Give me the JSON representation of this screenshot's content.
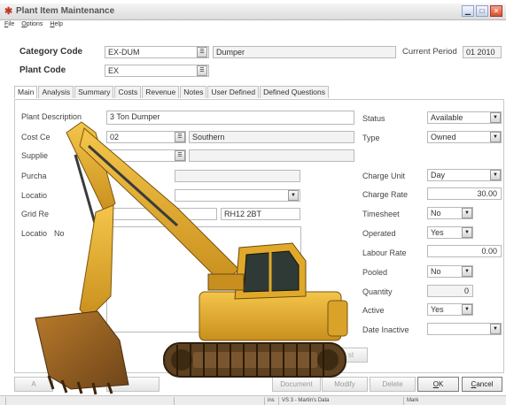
{
  "window": {
    "title": "Plant Item Maintenance"
  },
  "menu": [
    "File",
    "Options",
    "Help"
  ],
  "header": {
    "category_code_label": "Category Code",
    "category_code": "EX-DUM",
    "category_desc": "Dumper",
    "current_period_label": "Current Period",
    "current_period": "01 2010",
    "plant_code_label": "Plant Code",
    "plant_code": "EX"
  },
  "tabs": [
    "Main",
    "Analysis",
    "Summary",
    "Costs",
    "Revenue",
    "Notes",
    "User Defined",
    "Defined Questions"
  ],
  "main": {
    "plant_description_label": "Plant Description",
    "plant_description": "3 Ton Dumper",
    "cost_centre_label": "Cost Ce",
    "cost_centre_code": "02",
    "cost_centre_desc": "Southern",
    "supplier_label": "Supplie",
    "purchase_label": "Purcha",
    "location_label": "Locatio",
    "grid_ref_label": "Grid Re",
    "postcode": "RH12 2BT",
    "location_notes_label_a": "Locatio",
    "location_notes_label_b": "No"
  },
  "right": {
    "status_label": "Status",
    "status": "Available",
    "type_label": "Type",
    "type": "Owned",
    "charge_unit_label": "Charge Unit",
    "charge_unit": "Day",
    "charge_rate_label": "Charge Rate",
    "charge_rate": "30.00",
    "timesheet_label": "Timesheet",
    "timesheet": "No",
    "operated_label": "Operated",
    "operated": "Yes",
    "labour_rate_label": "Labour Rate",
    "labour_rate": "0.00",
    "pooled_label": "Pooled",
    "pooled": "No",
    "quantity_label": "Quantity",
    "quantity": "0",
    "active_label": "Active",
    "active": "Yes",
    "date_inactive_label": "Date Inactive",
    "date_inactive": ""
  },
  "buttons": {
    "list": "st",
    "a_button": "A",
    "document": "Document",
    "modify": "Modify",
    "delete": "Delete",
    "ok": "OK",
    "cancel": "Cancel"
  },
  "statusbar": {
    "db": "VS 3 - Martin's Data",
    "ins": "ins",
    "user": "Mark"
  },
  "colors": {
    "excavator_yellow": "#e8b12a",
    "track": "#6a4a22",
    "close": "#d4502a"
  }
}
